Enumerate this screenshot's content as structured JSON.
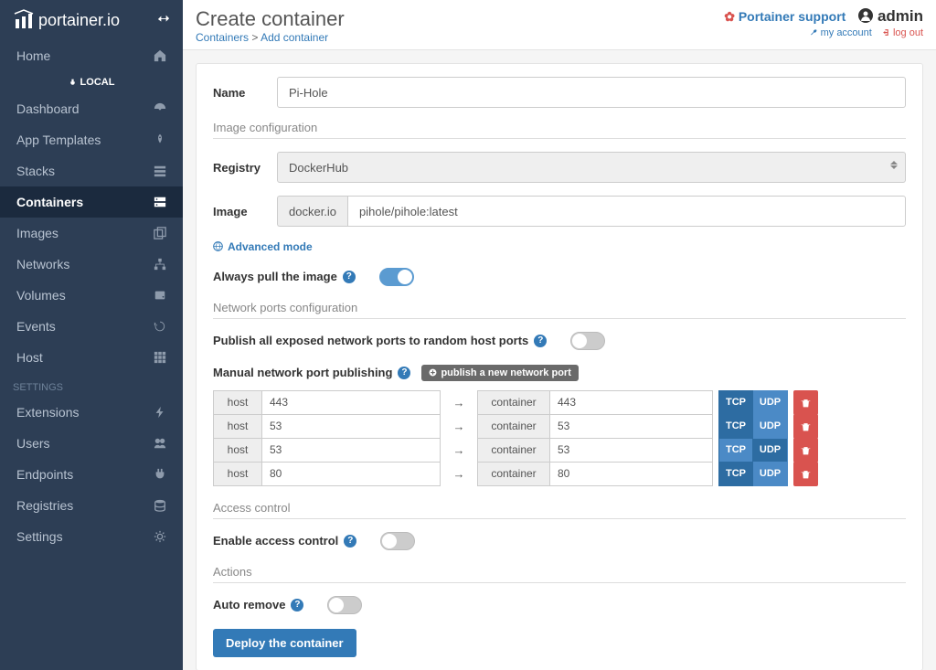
{
  "brand": "portainer.io",
  "header": {
    "title": "Create container",
    "breadcrumb_root": "Containers",
    "breadcrumb_current": "Add container",
    "support_label": "Portainer support",
    "user_name": "admin",
    "my_account_label": "my account",
    "logout_label": "log out"
  },
  "sidebar": {
    "endpoint_label": "LOCAL",
    "settings_heading": "SETTINGS",
    "home": "Home",
    "items": [
      {
        "label": "Dashboard",
        "icon": "dashboard"
      },
      {
        "label": "App Templates",
        "icon": "rocket"
      },
      {
        "label": "Stacks",
        "icon": "list"
      },
      {
        "label": "Containers",
        "icon": "server",
        "active": true
      },
      {
        "label": "Images",
        "icon": "clone"
      },
      {
        "label": "Networks",
        "icon": "sitemap"
      },
      {
        "label": "Volumes",
        "icon": "hdd"
      },
      {
        "label": "Events",
        "icon": "history"
      },
      {
        "label": "Host",
        "icon": "th"
      }
    ],
    "settings_items": [
      {
        "label": "Extensions",
        "icon": "bolt"
      },
      {
        "label": "Users",
        "icon": "users"
      },
      {
        "label": "Endpoints",
        "icon": "plug"
      },
      {
        "label": "Registries",
        "icon": "database"
      },
      {
        "label": "Settings",
        "icon": "cogs"
      }
    ]
  },
  "form": {
    "name_label": "Name",
    "name_value": "Pi-Hole",
    "section_image": "Image configuration",
    "registry_label": "Registry",
    "registry_value": "DockerHub",
    "image_label": "Image",
    "image_prefix": "docker.io",
    "image_value": "pihole/pihole:latest",
    "advanced_mode_label": "Advanced mode",
    "always_pull_label": "Always pull the image",
    "section_network": "Network ports configuration",
    "publish_all_label": "Publish all exposed network ports to random host ports",
    "manual_publish_label": "Manual network port publishing",
    "publish_new_label": "publish a new network port",
    "host_label": "host",
    "container_label": "container",
    "tcp_label": "TCP",
    "udp_label": "UDP",
    "ports": [
      {
        "host": "443",
        "container": "443",
        "protocol": "tcp"
      },
      {
        "host": "53",
        "container": "53",
        "protocol": "tcp"
      },
      {
        "host": "53",
        "container": "53",
        "protocol": "udp"
      },
      {
        "host": "80",
        "container": "80",
        "protocol": "tcp"
      }
    ],
    "section_access": "Access control",
    "access_control_label": "Enable access control",
    "section_actions": "Actions",
    "auto_remove_label": "Auto remove",
    "deploy_label": "Deploy the container"
  }
}
